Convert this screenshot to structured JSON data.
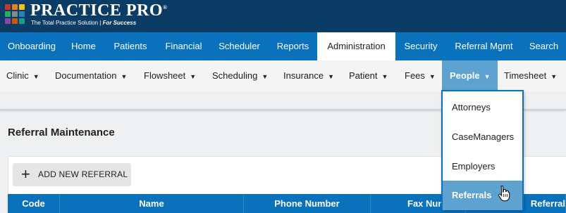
{
  "header": {
    "logo_text": "PRACTICE PRO",
    "logo_trademark": "®",
    "tagline": "The Total Practice Solution |",
    "tagline_emphasis": "For Success",
    "logo_colors": [
      "#c0392b",
      "#e67e22",
      "#f1c40f",
      "#27ae60",
      "#7f8c8d",
      "#2980b9",
      "#8e44ad",
      "#d35400",
      "#16a085"
    ]
  },
  "main_nav": {
    "items": [
      {
        "label": "Onboarding"
      },
      {
        "label": "Home"
      },
      {
        "label": "Patients"
      },
      {
        "label": "Financial"
      },
      {
        "label": "Scheduler"
      },
      {
        "label": "Reports"
      },
      {
        "label": "Administration",
        "active": true
      },
      {
        "label": "Security"
      },
      {
        "label": "Referral Mgmt"
      },
      {
        "label": "Search"
      }
    ]
  },
  "sub_nav": {
    "caret": "▼",
    "items": [
      {
        "label": "Clinic"
      },
      {
        "label": "Documentation"
      },
      {
        "label": "Flowsheet"
      },
      {
        "label": "Scheduling"
      },
      {
        "label": "Insurance"
      },
      {
        "label": "Patient"
      },
      {
        "label": "Fees"
      },
      {
        "label": "People",
        "active": true
      },
      {
        "label": "Timesheet"
      }
    ]
  },
  "dropdown": {
    "options": [
      {
        "label": "Attorneys"
      },
      {
        "label": "CaseManagers"
      },
      {
        "label": "Employers"
      },
      {
        "label": "Referrals",
        "hovered": true
      }
    ]
  },
  "page": {
    "title": "Referral Maintenance",
    "add_button_icon": "+",
    "add_button_label": "ADD NEW REFERRAL"
  },
  "table": {
    "columns": [
      "Code",
      "Name",
      "Phone Number",
      "Fax Num",
      "Referral"
    ]
  },
  "colors": {
    "header_bg": "#0a3c66",
    "nav_bg": "#0a72bd",
    "highlight": "#5ea2d1"
  }
}
